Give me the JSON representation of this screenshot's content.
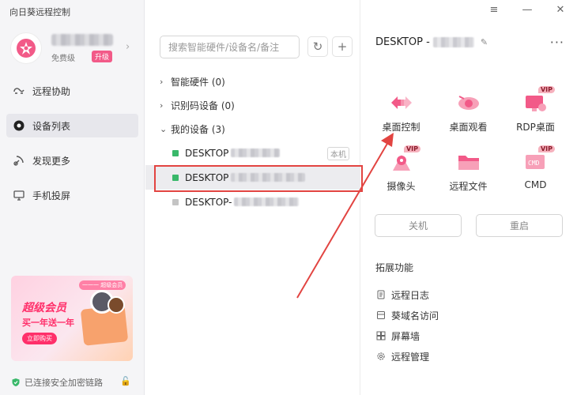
{
  "app": {
    "title": "向日葵远程控制"
  },
  "profile": {
    "tier": "免费级",
    "upgrade": "升级"
  },
  "sidebar": {
    "items": [
      {
        "label": "远程协助",
        "icon": "remote-assist-icon"
      },
      {
        "label": "设备列表",
        "icon": "device-list-icon"
      },
      {
        "label": "发现更多",
        "icon": "satellite-icon"
      },
      {
        "label": "手机投屏",
        "icon": "screen-cast-icon"
      }
    ],
    "promo": {
      "tag": "一一一 超级会员",
      "title": "超级会员",
      "subtitle": "买一年送一年",
      "button": "立即购买"
    },
    "security_status": "已连接安全加密链路"
  },
  "device_list": {
    "search_placeholder": "搜索智能硬件/设备名/备注",
    "groups": [
      {
        "label": "智能硬件 (0)",
        "expanded": false
      },
      {
        "label": "识别码设备 (0)",
        "expanded": false
      },
      {
        "label": "我的设备 (3)",
        "expanded": true
      }
    ],
    "devices": [
      {
        "name": "DESKTOP",
        "status": "online",
        "tag": "本机",
        "selected": false
      },
      {
        "name": "DESKTOP",
        "status": "online",
        "selected": true
      },
      {
        "name": "DESKTOP-",
        "status": "offline",
        "selected": false
      }
    ]
  },
  "detail": {
    "device_name": "DESKTOP -",
    "features": [
      {
        "label": "桌面控制",
        "vip": false,
        "icon": "desktop-control-icon"
      },
      {
        "label": "桌面观看",
        "vip": false,
        "icon": "desktop-view-icon"
      },
      {
        "label": "RDP桌面",
        "vip": true,
        "icon": "rdp-desktop-icon"
      },
      {
        "label": "摄像头",
        "vip": true,
        "icon": "camera-icon"
      },
      {
        "label": "远程文件",
        "vip": false,
        "icon": "remote-file-icon"
      },
      {
        "label": "CMD",
        "vip": true,
        "icon": "cmd-icon"
      }
    ],
    "vip_label": "VIP",
    "shutdown": "关机",
    "restart": "重启",
    "extensions_title": "拓展功能",
    "extensions": [
      {
        "label": "远程日志",
        "icon": "log-icon"
      },
      {
        "label": "葵域名访问",
        "icon": "domain-icon"
      },
      {
        "label": "屏幕墙",
        "icon": "screen-wall-icon"
      },
      {
        "label": "远程管理",
        "icon": "settings-icon"
      }
    ]
  },
  "colors": {
    "accent": "#f25a88",
    "online": "#39b86a",
    "highlight": "#e24441"
  }
}
